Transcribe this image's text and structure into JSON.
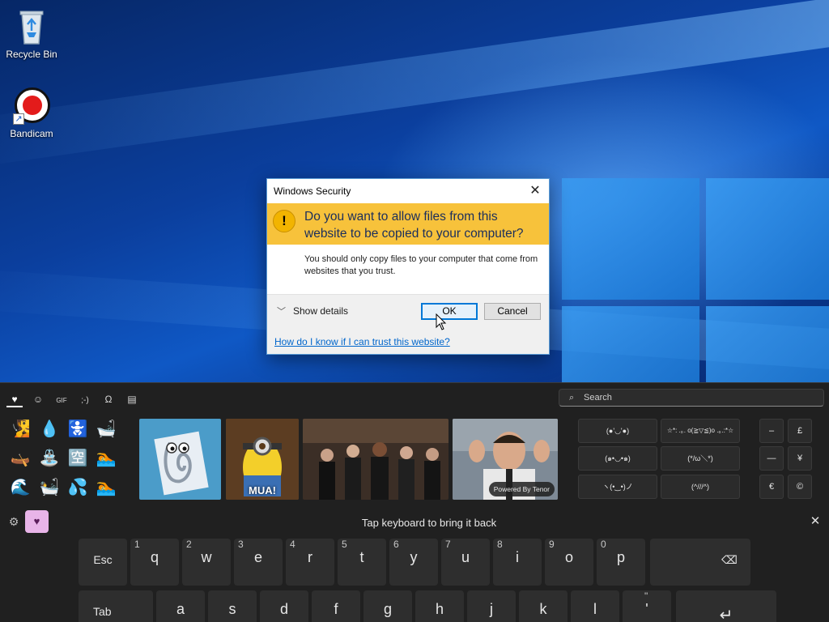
{
  "desktop": {
    "icons": [
      {
        "label": "Recycle Bin",
        "icon": "recycle-bin-icon"
      },
      {
        "label": "Bandicam",
        "icon": "bandicam-icon"
      }
    ]
  },
  "dialog": {
    "title": "Windows Security",
    "close_glyph": "✕",
    "question": "Do you want to allow files from this website to be copied to your computer?",
    "warning_glyph": "!",
    "body": "You should only copy files to your computer that come from websites that you trust.",
    "show_details": "Show details",
    "ok_label": "OK",
    "cancel_label": "Cancel",
    "help_link": "How do I know if I can trust this website?"
  },
  "panel": {
    "tabs": [
      {
        "glyph": "♥",
        "name": "tab-recent"
      },
      {
        "glyph": "☺",
        "name": "tab-emoji"
      },
      {
        "glyph": "GIF",
        "name": "tab-gif"
      },
      {
        "glyph": ";-)",
        "name": "tab-kaomoji"
      },
      {
        "glyph": "Ω",
        "name": "tab-symbols"
      },
      {
        "glyph": "▤",
        "name": "tab-clipboard"
      }
    ],
    "search_placeholder": "Search",
    "emojis": [
      "🧏",
      "💧",
      "🚼",
      "🛁",
      "🛶",
      "⛲",
      "🈳",
      "🏊",
      "🌊",
      "🛀",
      "💦",
      "🏊"
    ],
    "gifs": [
      {
        "caption": ""
      },
      {
        "caption": "MUA!"
      },
      {
        "caption": ""
      },
      {
        "caption": ""
      }
    ],
    "tenor_label": "Powered By Tenor",
    "kaomoji": [
      "(●'◡'●)",
      "☆*: .｡. o(≧▽≦)o .｡.:*☆",
      "(๑•◡•๑)",
      "(*/ω＼*)",
      "ヽ(•‿•)ノ",
      "(^///^)"
    ],
    "symbols": [
      "–",
      "£",
      "—",
      "¥",
      "€",
      "©"
    ],
    "tap_message": "Tap keyboard to bring it back",
    "close_glyph": "✕",
    "settings_glyph": "⚙",
    "keyboard_glyph": "♥"
  },
  "keyboard": {
    "row1": [
      {
        "main": "Esc",
        "hint": ""
      },
      {
        "main": "q",
        "hint": "1"
      },
      {
        "main": "w",
        "hint": "2"
      },
      {
        "main": "e",
        "hint": "3"
      },
      {
        "main": "r",
        "hint": "4"
      },
      {
        "main": "t",
        "hint": "5"
      },
      {
        "main": "y",
        "hint": "6"
      },
      {
        "main": "u",
        "hint": "7"
      },
      {
        "main": "i",
        "hint": "8"
      },
      {
        "main": "o",
        "hint": "9"
      },
      {
        "main": "p",
        "hint": "0"
      },
      {
        "main": "⌫",
        "hint": ""
      }
    ],
    "row2": [
      {
        "main": "Tab",
        "hint": ""
      },
      {
        "main": "a",
        "hint": ""
      },
      {
        "main": "s",
        "hint": ""
      },
      {
        "main": "d",
        "hint": ""
      },
      {
        "main": "f",
        "hint": ""
      },
      {
        "main": "g",
        "hint": ""
      },
      {
        "main": "h",
        "hint": ""
      },
      {
        "main": "j",
        "hint": ""
      },
      {
        "main": "k",
        "hint": ""
      },
      {
        "main": "l",
        "hint": ""
      },
      {
        "main": "'",
        "hint": "\""
      },
      {
        "main": "↵",
        "hint": ""
      }
    ]
  },
  "colors": {
    "banner": "#f7c23b",
    "link": "#0066cc",
    "panel_bg": "#202020",
    "accent_pink": "#e8b4e8"
  }
}
